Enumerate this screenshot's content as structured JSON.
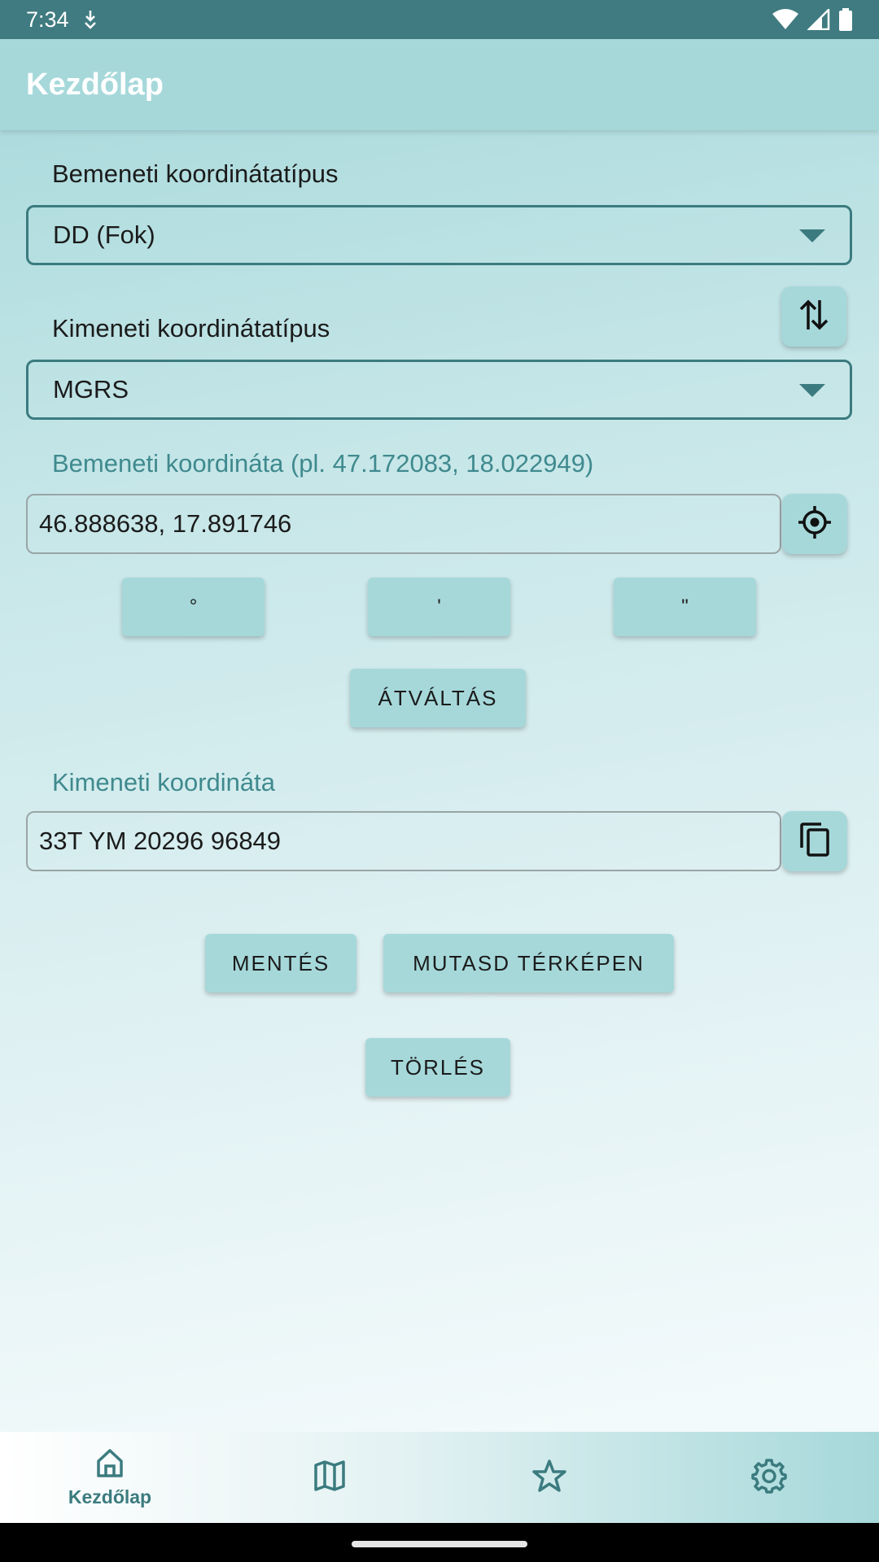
{
  "status_bar": {
    "time": "7:34"
  },
  "app_bar": {
    "title": "Kezdőlap"
  },
  "input_type": {
    "label": "Bemeneti koordinátatípus",
    "selected": "DD (Fok)"
  },
  "output_type": {
    "label": "Kimeneti koordinátatípus",
    "selected": "MGRS"
  },
  "input_coordinate": {
    "label": "Bemeneti koordináta (pl. 47.172083, 18.022949)",
    "value": "46.888638, 17.891746"
  },
  "symbol_buttons": {
    "degree": "°",
    "minute": "'",
    "second": "\""
  },
  "convert_button": "ÁTVÁLTÁS",
  "output_coordinate": {
    "label": "Kimeneti koordináta",
    "value": "33T YM 20296 96849"
  },
  "actions": {
    "save": "MENTÉS",
    "show_on_map": "MUTASD TÉRKÉPEN",
    "delete": "TÖRLÉS"
  },
  "bottom_nav": {
    "items": [
      {
        "label": "Kezdőlap",
        "icon": "home-icon",
        "active": true
      },
      {
        "label": "",
        "icon": "map-icon",
        "active": false
      },
      {
        "label": "",
        "icon": "star-icon",
        "active": false
      },
      {
        "label": "",
        "icon": "settings-icon",
        "active": false
      }
    ]
  },
  "colors": {
    "accent": "#3b7b7f",
    "button": "#a6d8da",
    "status_bar": "#3f7b80",
    "label_teal": "#3f8a8e"
  }
}
